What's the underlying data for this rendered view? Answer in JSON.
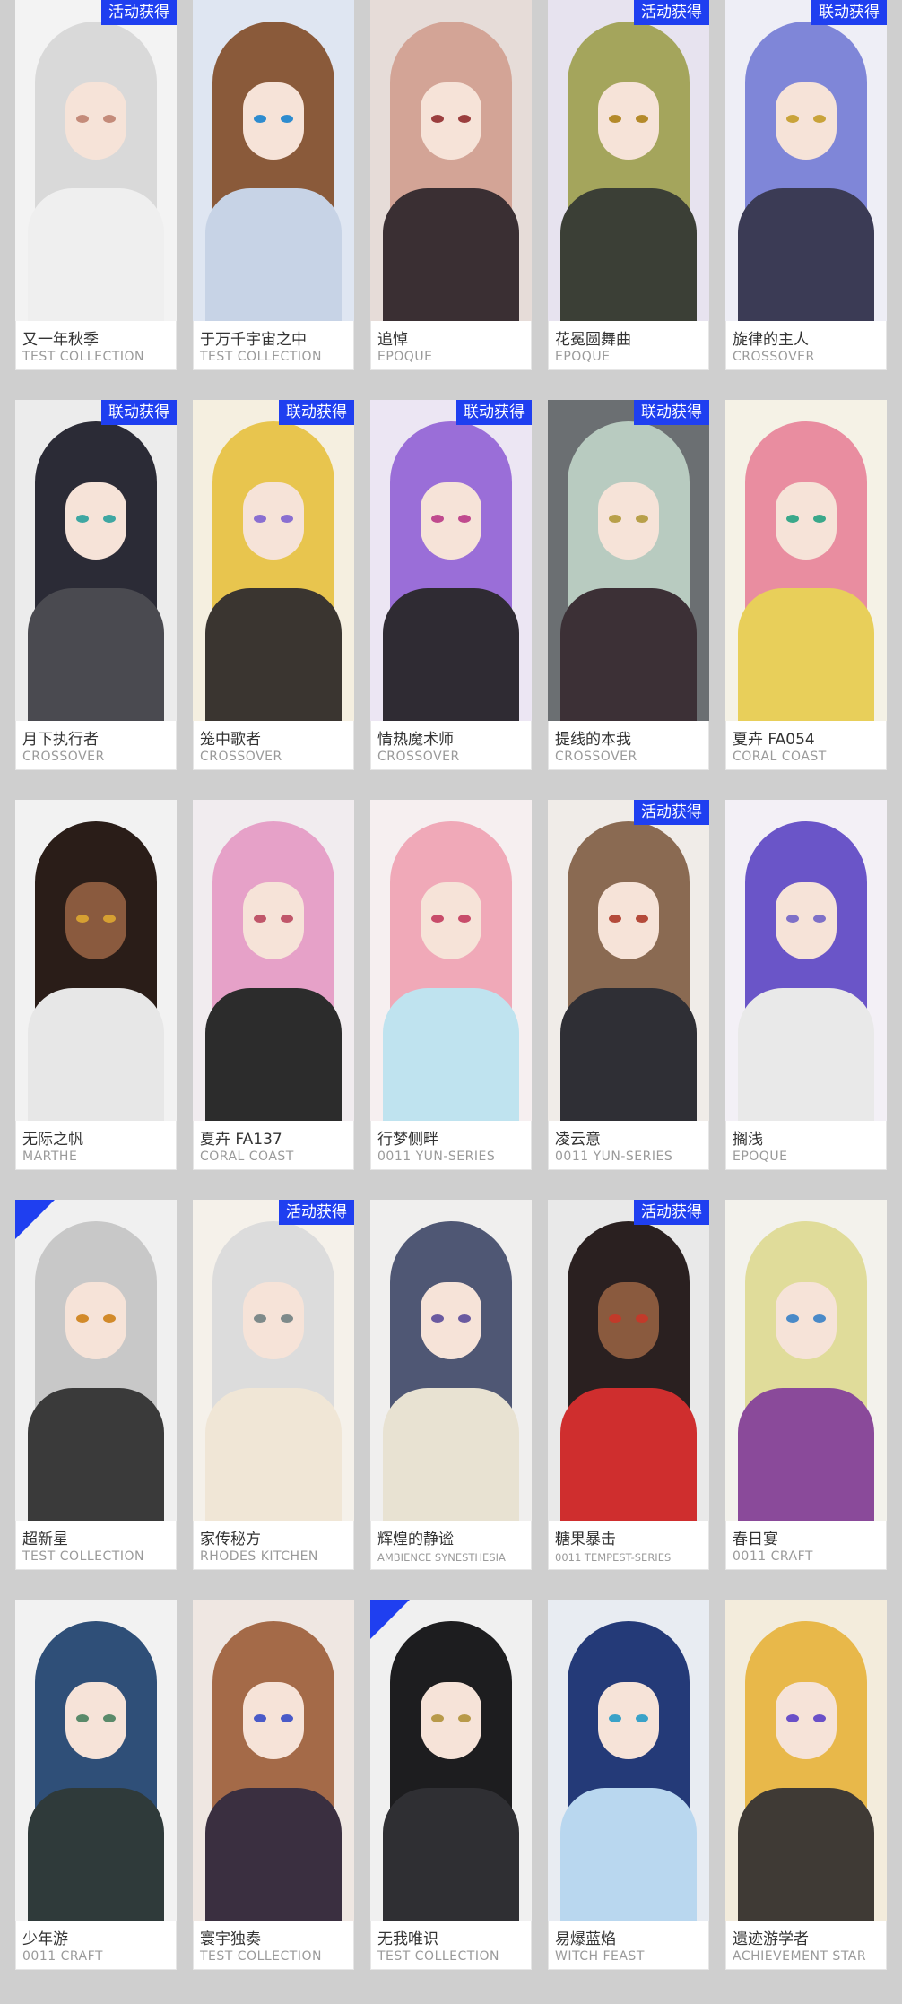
{
  "page": {
    "background": "#cfcfcf",
    "badge_color": "#1f3ff0"
  },
  "cards": [
    {
      "name": "又一年秋季",
      "series": "TEST COLLECTION",
      "badge": "活动获得",
      "hair": "#d9d9d9",
      "bodyc": "#efefef",
      "bg": "#f3f3f3",
      "eye": "#c48b7a"
    },
    {
      "name": "于万千宇宙之中",
      "series": "TEST COLLECTION",
      "badge": "",
      "hair": "#8a5a3a",
      "bodyc": "#c7d3e6",
      "bg": "#dfe6f2",
      "eye": "#2e8ccf"
    },
    {
      "name": "追悼",
      "series": "EPOQUE",
      "badge": "",
      "hair": "#d3a496",
      "bodyc": "#3a2f33",
      "bg": "#e6dcd8",
      "eye": "#9b3e3e"
    },
    {
      "name": "花冕圆舞曲",
      "series": "EPOQUE",
      "badge": "活动获得",
      "hair": "#a4a55c",
      "bodyc": "#3b3f36",
      "bg": "#e7e3ef",
      "eye": "#b48a2a"
    },
    {
      "name": "旋律的主人",
      "series": "CROSSOVER",
      "badge": "联动获得",
      "hair": "#7f86d8",
      "bodyc": "#3b3b55",
      "bg": "#eeeef6",
      "eye": "#c9a33a"
    },
    {
      "name": "月下执行者",
      "series": "CROSSOVER",
      "badge": "联动获得",
      "hair": "#2b2b36",
      "bodyc": "#4a4a50",
      "bg": "#ececec",
      "eye": "#3fa7a2"
    },
    {
      "name": "笼中歌者",
      "series": "CROSSOVER",
      "badge": "联动获得",
      "hair": "#e8c54e",
      "bodyc": "#3a3530",
      "bg": "#f5efe0",
      "eye": "#8a6fd1"
    },
    {
      "name": "情热魔术师",
      "series": "CROSSOVER",
      "badge": "联动获得",
      "hair": "#9a6ed8",
      "bodyc": "#2f2b33",
      "bg": "#ece6f3",
      "eye": "#c04a8e"
    },
    {
      "name": "提线的本我",
      "series": "CROSSOVER",
      "badge": "联动获得",
      "hair": "#b8cbc0",
      "bodyc": "#3c3036",
      "bg": "#6b6f72",
      "eye": "#b8a04a"
    },
    {
      "name": "夏卉 FA054",
      "series": "CORAL COAST",
      "badge": "",
      "hair": "#e98da0",
      "bodyc": "#e8cf5a",
      "bg": "#f5f2e6",
      "eye": "#3aa88a"
    },
    {
      "name": "无际之帆",
      "series": "MARTHE",
      "badge": "",
      "hair": "#2a1d18",
      "bodyc": "#e7e7e7",
      "bg": "#f2f2f2",
      "eye": "#d6a032",
      "skin": "#8a5a3e"
    },
    {
      "name": "夏卉 FA137",
      "series": "CORAL COAST",
      "badge": "",
      "hair": "#e6a1c8",
      "bodyc": "#2c2c2c",
      "bg": "#f1ecef",
      "eye": "#c0566a"
    },
    {
      "name": "行梦侧畔",
      "series": "0011 YUN-SERIES",
      "badge": "",
      "hair": "#f0a9b8",
      "bodyc": "#bfe3ef",
      "bg": "#f6eff0",
      "eye": "#c84c6a"
    },
    {
      "name": "凌云意",
      "series": "0011 YUN-SERIES",
      "badge": "活动获得",
      "hair": "#8a6a52",
      "bodyc": "#2f2f35",
      "bg": "#f0ece8",
      "eye": "#b44a3a"
    },
    {
      "name": "搁浅",
      "series": "EPOQUE",
      "badge": "",
      "hair": "#6a55c8",
      "bodyc": "#e9e9e9",
      "bg": "#f3f0f6",
      "eye": "#7e70c8"
    },
    {
      "name": "超新星",
      "series": "TEST COLLECTION",
      "badge": "",
      "corner": true,
      "hair": "#c8c8c8",
      "bodyc": "#3a3a3a",
      "bg": "#f0f0f0",
      "eye": "#d28a2a"
    },
    {
      "name": "家传秘方",
      "series": "RHODES KITCHEN",
      "badge": "活动获得",
      "hair": "#dcdcdc",
      "bodyc": "#f0e6d6",
      "bg": "#f5f1ea",
      "eye": "#7e8a8a"
    },
    {
      "name": "辉煌的静谧",
      "series": "AMBIENCE SYNESTHESIA",
      "small": true,
      "badge": "",
      "hair": "#4f5774",
      "bodyc": "#e8e2d2",
      "bg": "#f0efee",
      "eye": "#6a5aa0"
    },
    {
      "name": "糖果暴击",
      "series": "0011 TEMPEST-SERIES",
      "small": true,
      "badge": "活动获得",
      "hair": "#2a2020",
      "bodyc": "#cf2e2e",
      "bg": "#e9e9e9",
      "eye": "#c23a2a",
      "skin": "#8a5a3e"
    },
    {
      "name": "春日宴",
      "series": "0011 CRAFT",
      "badge": "",
      "hair": "#e0dc9a",
      "bodyc": "#8a4a9a",
      "bg": "#f3f2ec",
      "eye": "#4a8ac8"
    },
    {
      "name": "少年游",
      "series": "0011 CRAFT",
      "badge": "",
      "hair": "#2f4f78",
      "bodyc": "#2f3a3a",
      "bg": "#f2f2f2",
      "eye": "#5a8a6a"
    },
    {
      "name": "寰宇独奏",
      "series": "TEST COLLECTION",
      "badge": "",
      "hair": "#a46a48",
      "bodyc": "#3a2f40",
      "bg": "#efe7e2",
      "eye": "#4a5ac8"
    },
    {
      "name": "无我唯识",
      "series": "TEST COLLECTION",
      "badge": "",
      "corner": true,
      "hair": "#1d1d1f",
      "bodyc": "#2f2f33",
      "bg": "#f0f0f0",
      "eye": "#b89a4a"
    },
    {
      "name": "易爆蓝焰",
      "series": "WITCH FEAST",
      "badge": "",
      "hair": "#243a78",
      "bodyc": "#b9d7ef",
      "bg": "#e8ecf2",
      "eye": "#3aa2c8"
    },
    {
      "name": "遗迹游学者",
      "series": "ACHIEVEMENT STAR",
      "badge": "",
      "hair": "#e8b84a",
      "bodyc": "#3f3a35",
      "bg": "#f3ecdc",
      "eye": "#6a50c8"
    }
  ]
}
